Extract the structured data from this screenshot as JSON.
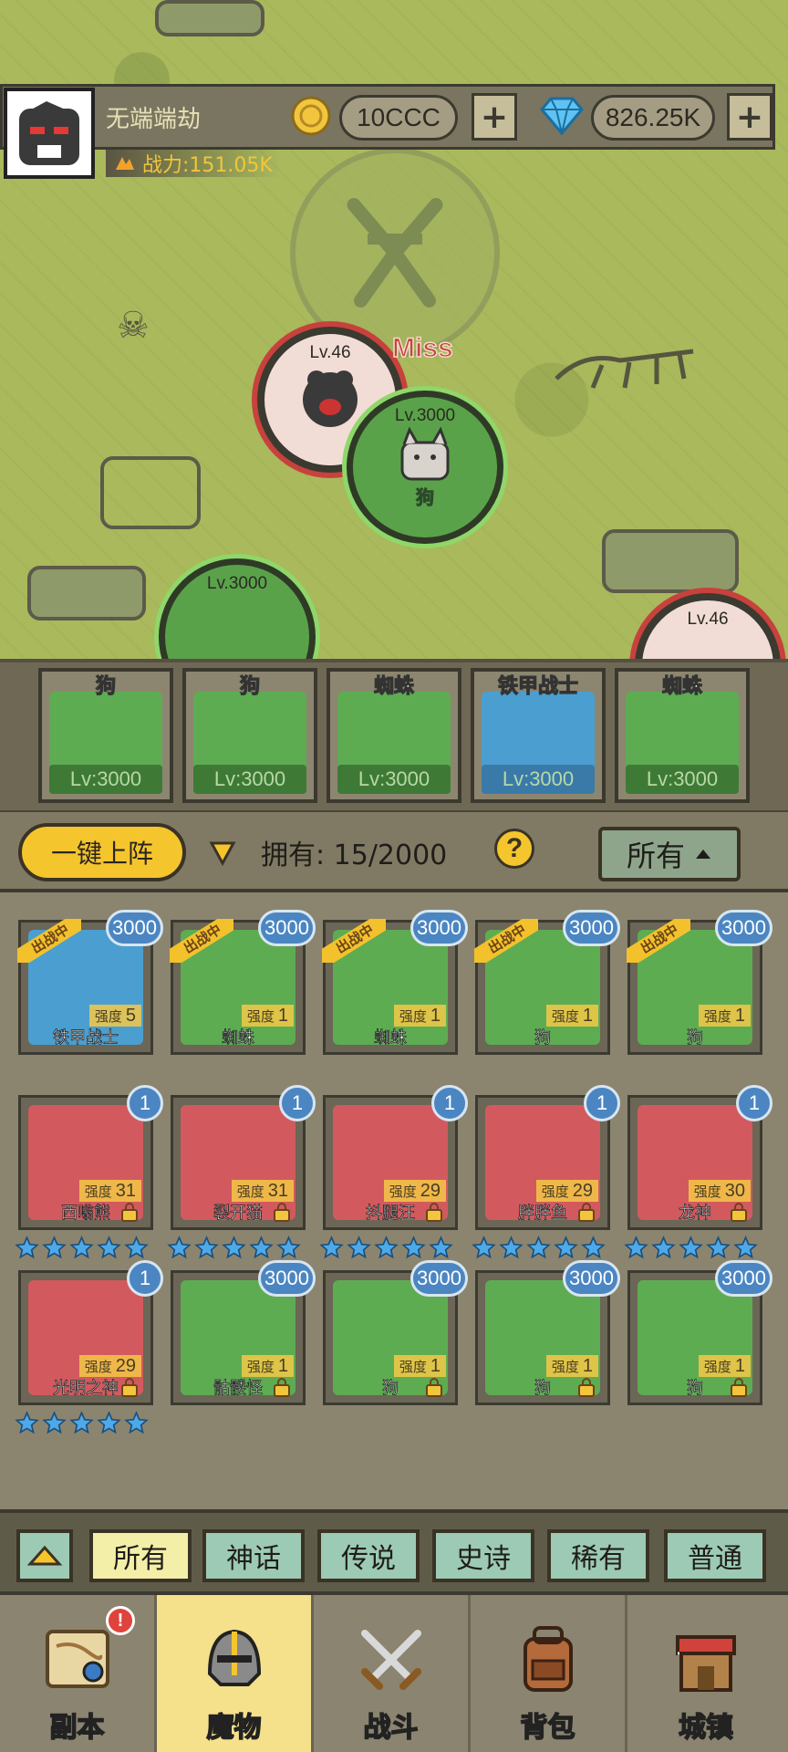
{
  "header": {
    "player_name": "无端端劫",
    "power": "战力:151.05K",
    "gold": "10CCC",
    "gems": "826.25K",
    "plus": "+"
  },
  "map": {
    "miss_text": "Miss",
    "units": [
      {
        "lv": "Lv.46",
        "name": "",
        "side": "enemy"
      },
      {
        "lv": "Lv.3000",
        "name": "狗",
        "side": "ally"
      },
      {
        "lv": "Lv.3000",
        "name": "",
        "side": "ally"
      },
      {
        "lv": "Lv.46",
        "name": "",
        "side": "enemy"
      }
    ]
  },
  "formation": [
    {
      "name": "狗",
      "lv": "Lv:3000"
    },
    {
      "name": "狗",
      "lv": "Lv:3000"
    },
    {
      "name": "蜘蛛",
      "lv": "Lv:3000"
    },
    {
      "name": "铁甲战士",
      "lv": "Lv:3000"
    },
    {
      "name": "蜘蛛",
      "lv": "Lv:3000"
    }
  ],
  "toolbar": {
    "deploy_label": "一键上阵",
    "owned_label": "拥有: 15/2000",
    "help": "?",
    "filter_label": "所有"
  },
  "monsters": [
    {
      "name": "铁甲战士",
      "badge": "3000",
      "strength_label": "强度",
      "strength": "5",
      "tag": "出战中",
      "bg": "blue",
      "stars": 0,
      "locked": false
    },
    {
      "name": "蜘蛛",
      "badge": "3000",
      "strength_label": "强度",
      "strength": "1",
      "tag": "出战中",
      "bg": "green",
      "stars": 0,
      "locked": false
    },
    {
      "name": "蜘蛛",
      "badge": "3000",
      "strength_label": "强度",
      "strength": "1",
      "tag": "出战中",
      "bg": "green",
      "stars": 0,
      "locked": false
    },
    {
      "name": "狗",
      "badge": "3000",
      "strength_label": "强度",
      "strength": "1",
      "tag": "出战中",
      "bg": "green",
      "stars": 0,
      "locked": false
    },
    {
      "name": "狗",
      "badge": "3000",
      "strength_label": "强度",
      "strength": "1",
      "tag": "出战中",
      "bg": "green",
      "stars": 0,
      "locked": false
    },
    {
      "name": "西嗡熊",
      "badge": "1",
      "strength_label": "强度",
      "strength": "31",
      "tag": "",
      "bg": "red",
      "stars": 5,
      "locked": true
    },
    {
      "name": "裂开猫",
      "badge": "1",
      "strength_label": "强度",
      "strength": "31",
      "tag": "",
      "bg": "red",
      "stars": 5,
      "locked": true
    },
    {
      "name": "抖腿汪",
      "badge": "1",
      "strength_label": "强度",
      "strength": "29",
      "tag": "",
      "bg": "red",
      "stars": 5,
      "locked": true
    },
    {
      "name": "胖胖鱼",
      "badge": "1",
      "strength_label": "强度",
      "strength": "29",
      "tag": "",
      "bg": "red",
      "stars": 5,
      "locked": true
    },
    {
      "name": "龙神",
      "badge": "1",
      "strength_label": "强度",
      "strength": "30",
      "tag": "",
      "bg": "red",
      "stars": 5,
      "locked": true
    },
    {
      "name": "光明之神",
      "badge": "1",
      "strength_label": "强度",
      "strength": "29",
      "tag": "",
      "bg": "red",
      "stars": 5,
      "locked": true
    },
    {
      "name": "骷髅怪",
      "badge": "3000",
      "strength_label": "强度",
      "strength": "1",
      "tag": "",
      "bg": "green",
      "stars": 0,
      "locked": true
    },
    {
      "name": "狗",
      "badge": "3000",
      "strength_label": "强度",
      "strength": "1",
      "tag": "",
      "bg": "green",
      "stars": 0,
      "locked": true
    },
    {
      "name": "狗",
      "badge": "3000",
      "strength_label": "强度",
      "strength": "1",
      "tag": "",
      "bg": "green",
      "stars": 0,
      "locked": true
    },
    {
      "name": "狗",
      "badge": "3000",
      "strength_label": "强度",
      "strength": "1",
      "tag": "",
      "bg": "green",
      "stars": 0,
      "locked": true
    }
  ],
  "rarity_tabs": [
    "所有",
    "神话",
    "传说",
    "史诗",
    "稀有",
    "普通"
  ],
  "bottom_nav": [
    {
      "label": "副本",
      "icon": "map-scroll-icon",
      "alert": "!"
    },
    {
      "label": "魔物",
      "icon": "helmet-icon",
      "active": true
    },
    {
      "label": "战斗",
      "icon": "crossed-swords-icon"
    },
    {
      "label": "背包",
      "icon": "backpack-icon"
    },
    {
      "label": "城镇",
      "icon": "shop-icon"
    }
  ],
  "colors": {
    "gold": "#f5c52d",
    "ally_green": "#5aa24a",
    "enemy_red": "#c8413c",
    "star_blue": "#4ea9e8"
  }
}
